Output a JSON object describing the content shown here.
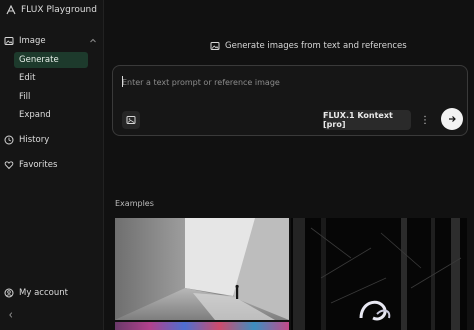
{
  "app": {
    "title": "FLUX Playground"
  },
  "sidebar": {
    "image_group": {
      "label": "Image",
      "icon": "image-icon",
      "expanded": true
    },
    "sub_items": [
      {
        "label": "Generate",
        "active": true
      },
      {
        "label": "Edit",
        "active": false
      },
      {
        "label": "Fill",
        "active": false
      },
      {
        "label": "Expand",
        "active": false
      }
    ],
    "history": {
      "label": "History",
      "icon": "clock-icon"
    },
    "favorites": {
      "label": "Favorites",
      "icon": "heart-icon"
    },
    "account": {
      "label": "My account",
      "icon": "user-circle-icon"
    },
    "collapse_icon": "chevron-left-icon"
  },
  "main": {
    "headline": "Generate images from text and references",
    "prompt": {
      "placeholder": "Enter a text prompt or reference image",
      "value": ""
    },
    "model_label": "FLUX.1 Kontext [pro]",
    "examples_label": "Examples"
  },
  "colors": {
    "background": "#111111",
    "sidebar": "#151515",
    "active_item": "#1d3a2c",
    "send_button": "#f2f2f2"
  }
}
